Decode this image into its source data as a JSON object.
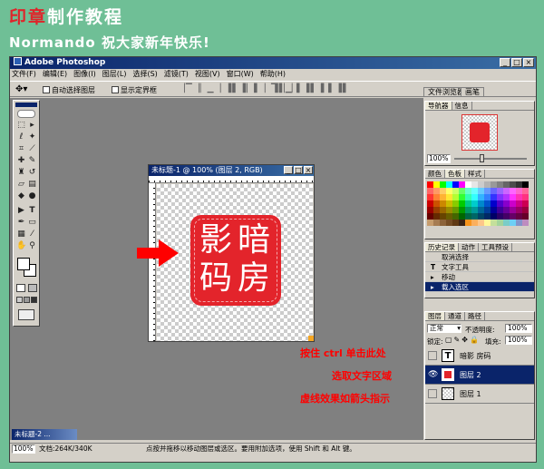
{
  "tutorial": {
    "title_red": "印章",
    "title_rest": "制作教程",
    "subtitle": "Normando 祝大家新年快乐!"
  },
  "app": {
    "title": "Adobe Photoshop",
    "min": "_",
    "max": "□",
    "close": "×"
  },
  "menu": [
    "文件(F)",
    "编辑(E)",
    "图像(I)",
    "图层(L)",
    "选择(S)",
    "滤镜(T)",
    "视图(V)",
    "窗口(W)",
    "帮助(H)"
  ],
  "options": {
    "auto_select": "自动选择图层",
    "show_bounds": "显示定界框"
  },
  "dock_tabs": [
    "文件浏览器",
    "画笔"
  ],
  "document": {
    "title": "未标题-1 @ 100% (图层 2, RGB)",
    "seal_chars": [
      "暗",
      "影",
      "房",
      "码"
    ]
  },
  "navigator": {
    "tabs": [
      "导航器",
      "信息"
    ],
    "zoom": "100%"
  },
  "color_panel": {
    "tabs": [
      "颜色",
      "色板",
      "样式"
    ]
  },
  "history": {
    "tabs": [
      "历史记录",
      "动作",
      "工具预设"
    ],
    "items": [
      "取消选择",
      "文字工具",
      "移动",
      "载入选区"
    ]
  },
  "layers": {
    "tabs": [
      "图层",
      "通道",
      "路径"
    ],
    "mode": "正常",
    "opacity_label": "不透明度:",
    "opacity": "100%",
    "lock_label": "锁定:",
    "fill_label": "填充:",
    "fill": "100%",
    "items": [
      {
        "name": "暗影 房码",
        "kind": "T"
      },
      {
        "name": "图层 2",
        "kind": "seal"
      },
      {
        "name": "图层 1",
        "kind": "empty"
      }
    ]
  },
  "annotations": [
    "按住 ctrl 单击此处",
    "选取文字区域",
    "虚线效果如箭头指示"
  ],
  "status": {
    "zoom": "100%",
    "doc": "文档:264K/340K",
    "hint": "点按并拖移以移动图层或选区。要用附加选项，使用 Shift 和 Alt 键。"
  },
  "taskbar": {
    "label": "未标题-2 ..."
  },
  "colors": {
    "seal_red": "#e3242b",
    "title_blue": "#0a246a",
    "annotation": "#ff0000"
  }
}
